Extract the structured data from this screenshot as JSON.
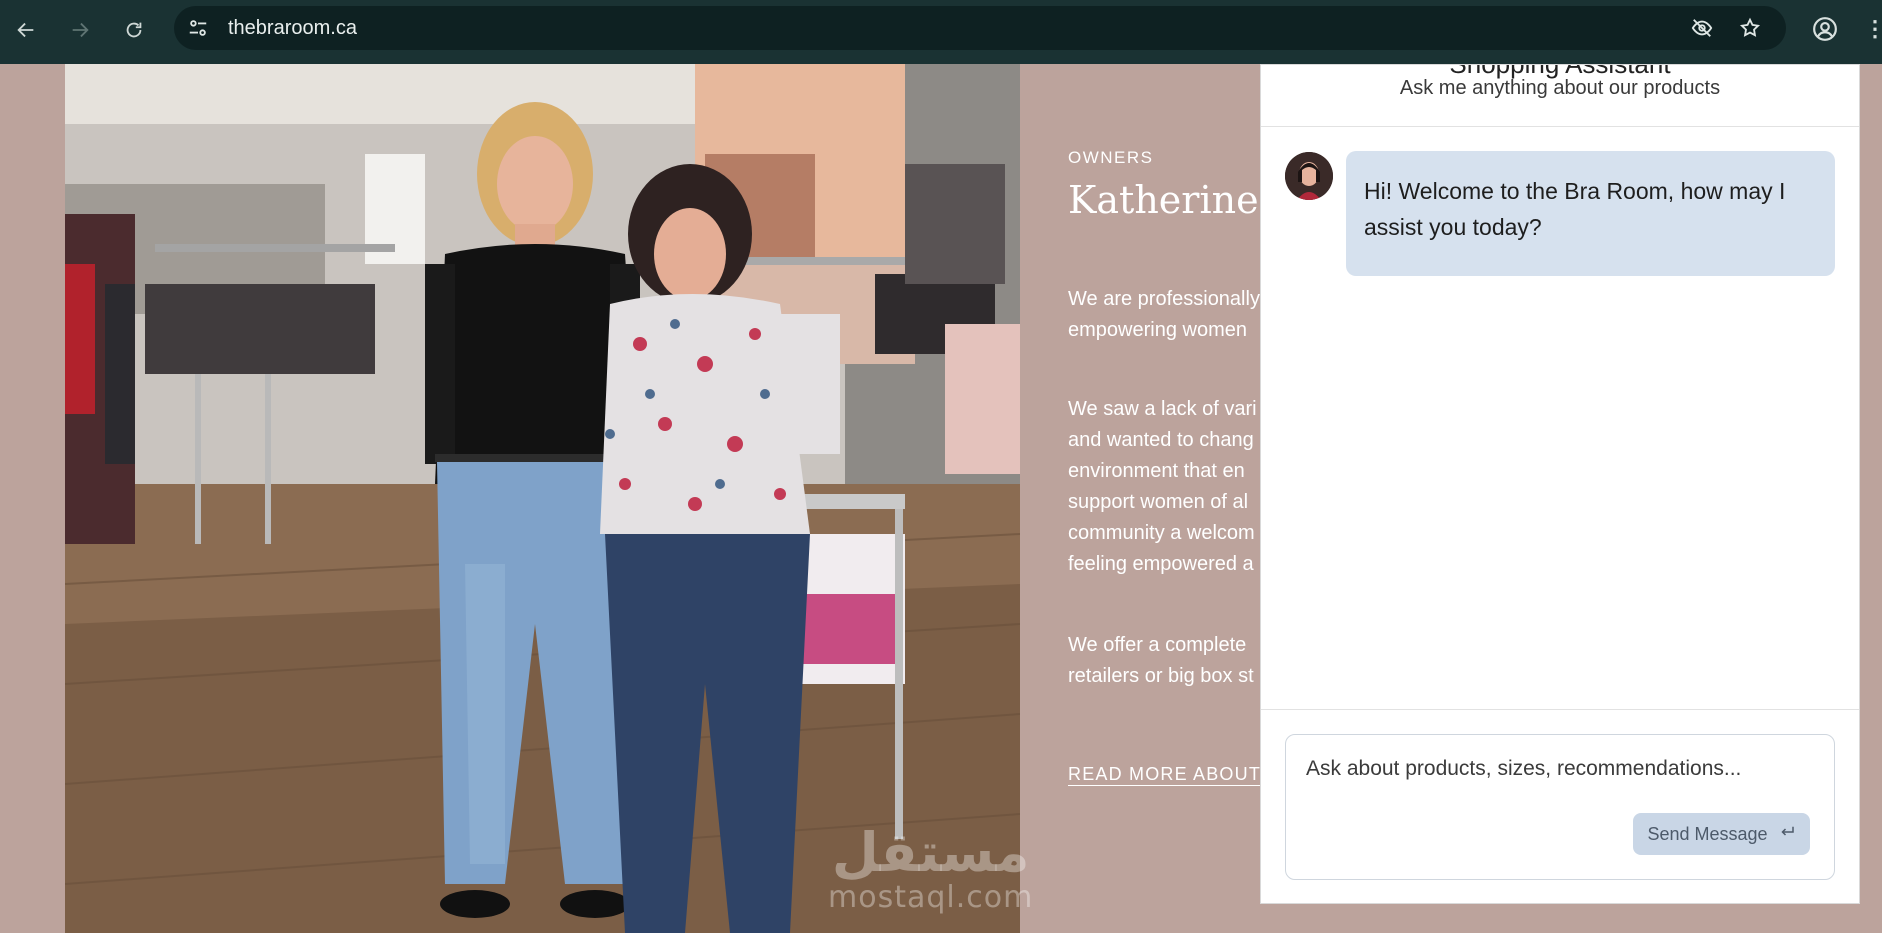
{
  "browser": {
    "url": "thebraroom.ca",
    "icons": [
      "back-icon",
      "forward-icon",
      "reload-icon",
      "site-info-icon",
      "eye-off-icon",
      "star-icon",
      "profile-icon",
      "kebab-menu-icon"
    ]
  },
  "about": {
    "eyebrow": "OWNERS",
    "heading": "Katherine &",
    "paragraph1": [
      "We are professionally",
      "empowering women"
    ],
    "paragraph2": [
      "We saw a lack of vari",
      "and wanted to chang",
      "environment that en",
      "support women of al",
      "community a welcom",
      "feeling empowered a"
    ],
    "paragraph3": [
      "We offer a complete",
      "retailers or big box st"
    ],
    "read_more": "READ MORE ABOUT"
  },
  "watermark": {
    "line1": "مستقل",
    "line2": "mostaql.com"
  },
  "chat": {
    "title": "Shopping Assistant",
    "subtitle": "Ask me anything about our products",
    "messages": [
      {
        "sender": "assistant",
        "text": "Hi! Welcome to the Bra Room, how may I assist you today?"
      }
    ],
    "input_placeholder": "Ask about products, sizes, recommendations...",
    "send_label": "Send Message"
  },
  "colors": {
    "page_bg": "#bca39c",
    "browser_bar": "#1a3233",
    "bubble": "#d6e1ee",
    "send_button": "#c9d6e6"
  }
}
